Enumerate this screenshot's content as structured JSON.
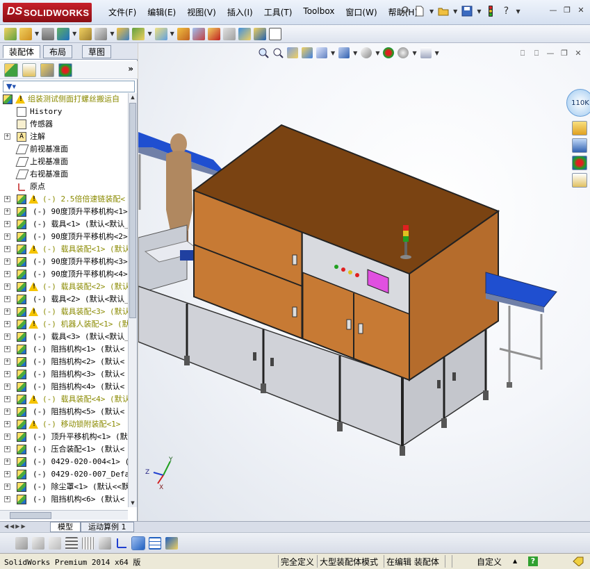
{
  "app": {
    "logo_ds": "DS",
    "logo_name": "SOLIDWORKS",
    "menu": [
      "文件(F)",
      "编辑(E)",
      "视图(V)",
      "插入(I)",
      "工具(T)",
      "Toolbox",
      "窗口(W)",
      "帮助(H)"
    ]
  },
  "panel": {
    "tabs": [
      "装配体",
      "布局",
      "草图"
    ],
    "more": "»"
  },
  "tree": {
    "root": "组装测试侧面打螺丝搬运自",
    "fixed": [
      "History",
      "传感器",
      "注解",
      "前视基准面",
      "上视基准面",
      "右视基准面",
      "原点"
    ],
    "components": [
      {
        "label": "(-) 2.5倍倍速链装配<",
        "warn": true
      },
      {
        "label": "(-) 90度顶升平移机构<1>",
        "warn": false
      },
      {
        "label": "(-) 载具<1> (默认<默认_",
        "warn": false
      },
      {
        "label": "(-) 90度顶升平移机构<2>",
        "warn": false
      },
      {
        "label": "(-) 载具装配<1> (默认",
        "warn": true
      },
      {
        "label": "(-) 90度顶升平移机构<3>",
        "warn": false
      },
      {
        "label": "(-) 90度顶升平移机构<4>",
        "warn": false
      },
      {
        "label": "(-) 载具装配<2> (默认",
        "warn": true
      },
      {
        "label": "(-) 载具<2> (默认<默认_",
        "warn": false
      },
      {
        "label": "(-) 载具装配<3> (默认",
        "warn": true
      },
      {
        "label": "(-) 机器人装配<1> (默",
        "warn": true
      },
      {
        "label": "(-) 载具<3> (默认<默认_",
        "warn": false
      },
      {
        "label": "(-) 阻挡机构<1> (默认<",
        "warn": false
      },
      {
        "label": "(-) 阻挡机构<2> (默认<",
        "warn": false
      },
      {
        "label": "(-) 阻挡机构<3> (默认<",
        "warn": false
      },
      {
        "label": "(-) 阻挡机构<4> (默认<",
        "warn": false
      },
      {
        "label": "(-) 载具装配<4> (默认",
        "warn": true
      },
      {
        "label": "(-) 阻挡机构<5> (默认<",
        "warn": false
      },
      {
        "label": "(-) 移动锁附装配<1>",
        "warn": true
      },
      {
        "label": "(-) 顶升平移机构<1> (默",
        "warn": false
      },
      {
        "label": "(-) 压合装配<1> (默认<",
        "warn": false
      },
      {
        "label": "(-) 0429-020-004<1> (默",
        "warn": false
      },
      {
        "label": "(-) 0429-020-007_Defaul",
        "warn": false
      },
      {
        "label": "(-) 除尘罩<1> (默认<<默",
        "warn": false
      },
      {
        "label": "(-) 阻挡机构<6> (默认<",
        "warn": false
      }
    ]
  },
  "viewport": {
    "speed_label": "110K"
  },
  "triad": {
    "x": "X",
    "y": "Y",
    "z": "Z"
  },
  "bottom_tabs": [
    "模型",
    "运动算例 1"
  ],
  "status": {
    "product": "SolidWorks Premium 2014 x64 版",
    "defined": "完全定义",
    "large_mode": "大型装配体模式",
    "editing": "在编辑 装配体",
    "custom": "自定义",
    "help": "?"
  },
  "colors": {
    "warning": "#f5c400",
    "warn_text": "#8a8a00",
    "conveyor_blue": "#1f4fd0",
    "cabinet_top": "#7a4312",
    "cabinet_panel": "#c77a34"
  }
}
